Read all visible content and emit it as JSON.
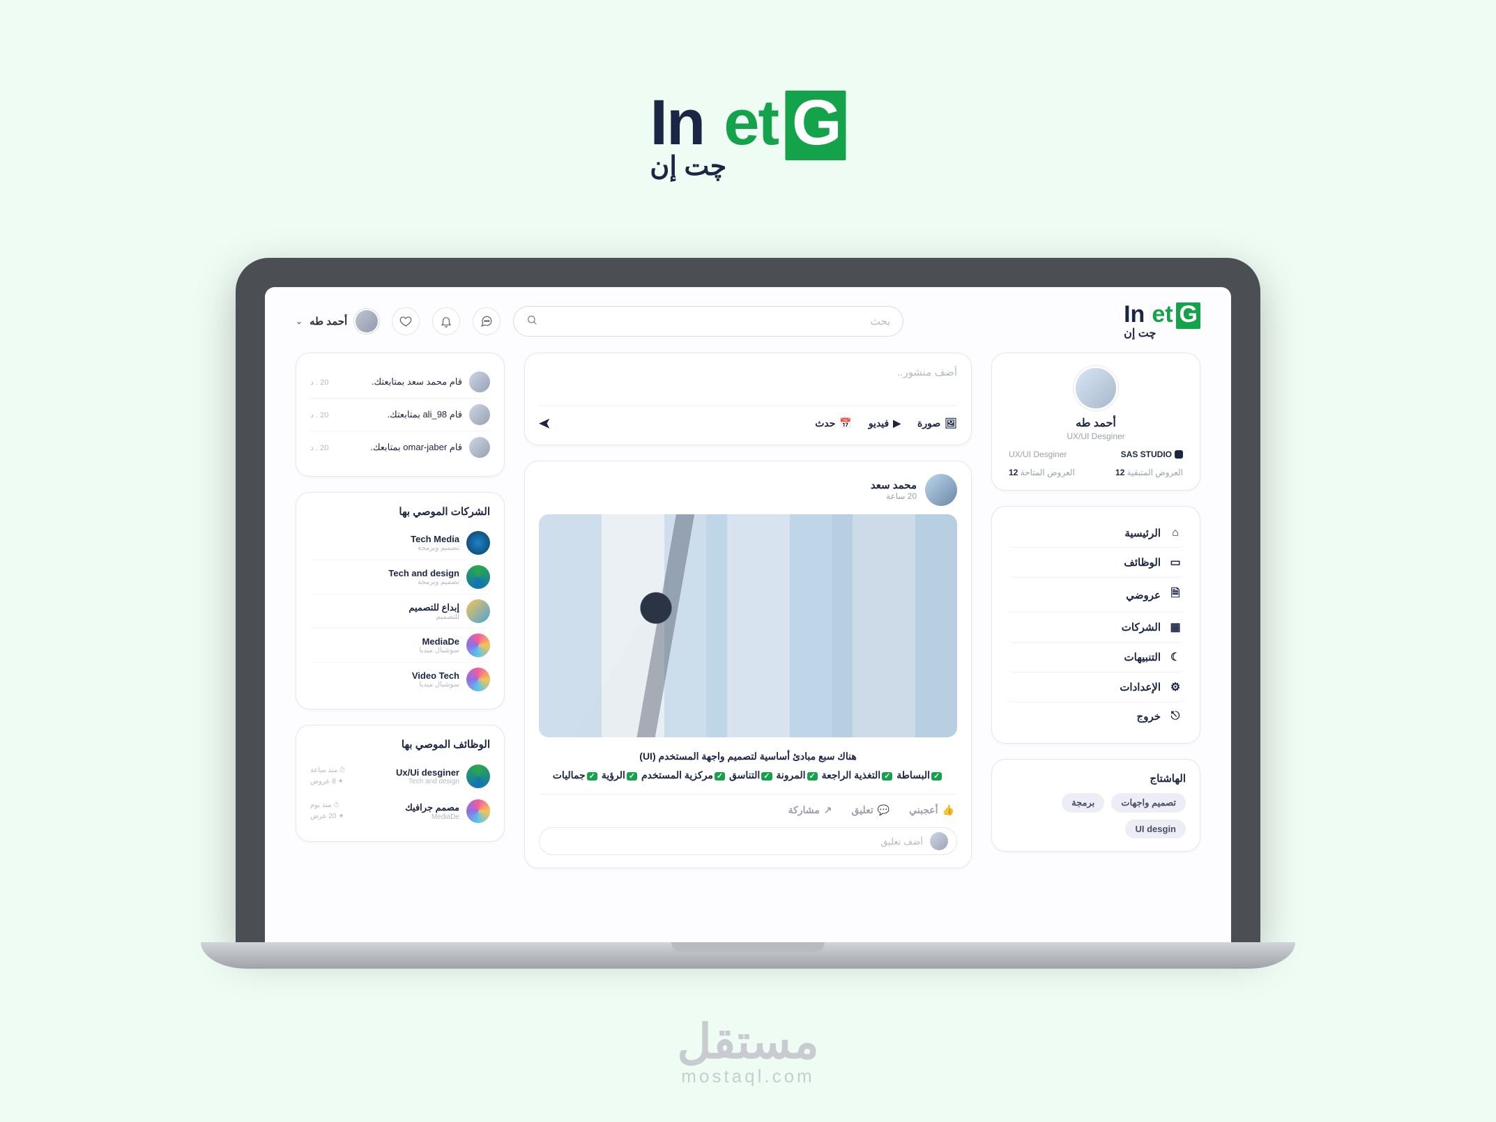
{
  "branding": {
    "hero_g": "G",
    "hero_et": "et",
    "hero_in": "In",
    "hero_sub": "چت إن",
    "watermark_ar": "مستقل",
    "watermark_en": "mostaql.com"
  },
  "header": {
    "search_placeholder": "بحث",
    "user_name": "أحمد طه"
  },
  "profile": {
    "name": "أحمد طه",
    "role": "UX/UI Desginer",
    "studio_label": "SAS STUDIO",
    "role2": "UX/UI Desginer",
    "remaining_label": "العروض المتبقية",
    "remaining_val": "12",
    "available_label": "العروض المتاحة",
    "available_val": "12"
  },
  "nav": {
    "home": "الرئيسية",
    "jobs": "الوظائف",
    "offers": "عروضي",
    "companies": "الشركات",
    "alerts": "التنبيهات",
    "settings": "الإعدادات",
    "logout": "خروج"
  },
  "hashtag_title": "الهاشتاج",
  "tags": {
    "t1": "تصميم واجهات",
    "t2": "برمجة",
    "t3": "UI desgin"
  },
  "compose": {
    "placeholder": "أضف منشور..",
    "image": "صورة",
    "video": "فيديو",
    "event": "حدث"
  },
  "post": {
    "author": "محمد  سعد",
    "time": "20 ساعة",
    "line1": "هناك سبع مبادئ أساسية لتصميم واجهة المستخدم (UI)",
    "p1": "البساطة",
    "p2": "التغذية الراجعة",
    "p3": "المرونة",
    "p4": "التناسق",
    "p5": "مركزية المستخدم",
    "p6": "الرؤية",
    "p7": "جماليات",
    "like": "أعجبني",
    "comment": "تعليق",
    "share": "مشاركة",
    "comment_placeholder": "أضف تعليق"
  },
  "notif_items": {
    "n1": "قام محمد سعد  بمتابعتك.",
    "t1": "20 . د",
    "n2": "قام ali_98  بمتابعتك.",
    "t2": "20 . د",
    "n3": "قام omar-jaber  بمتابعك.",
    "t3": "20 . د"
  },
  "companies_title": "الشركات الموصي  بها",
  "companies": {
    "c1n": "Tech Media",
    "c1s": "تصميم وبرمجة",
    "c2n": "Tech and design",
    "c2s": "تصميم وبرمجة",
    "c3n": "إبداع للتصميم",
    "c3s": "للتصميم",
    "c4n": "MediaDe",
    "c4s": "سوشيال ميديا",
    "c5n": "Video Tech",
    "c5s": "سوشيال ميديا"
  },
  "jobs_title": "الوظائف الموصي  بها",
  "jobs": {
    "j1t": "Ux/Ui desginer",
    "j1c": "Tech and design",
    "j1a": "منذ ساعة",
    "j1b": "8 عروض",
    "j2t": "مصمم جرافيك",
    "j2c": "MediaDe",
    "j2a": "منذ يوم",
    "j2b": "20 عرض"
  }
}
